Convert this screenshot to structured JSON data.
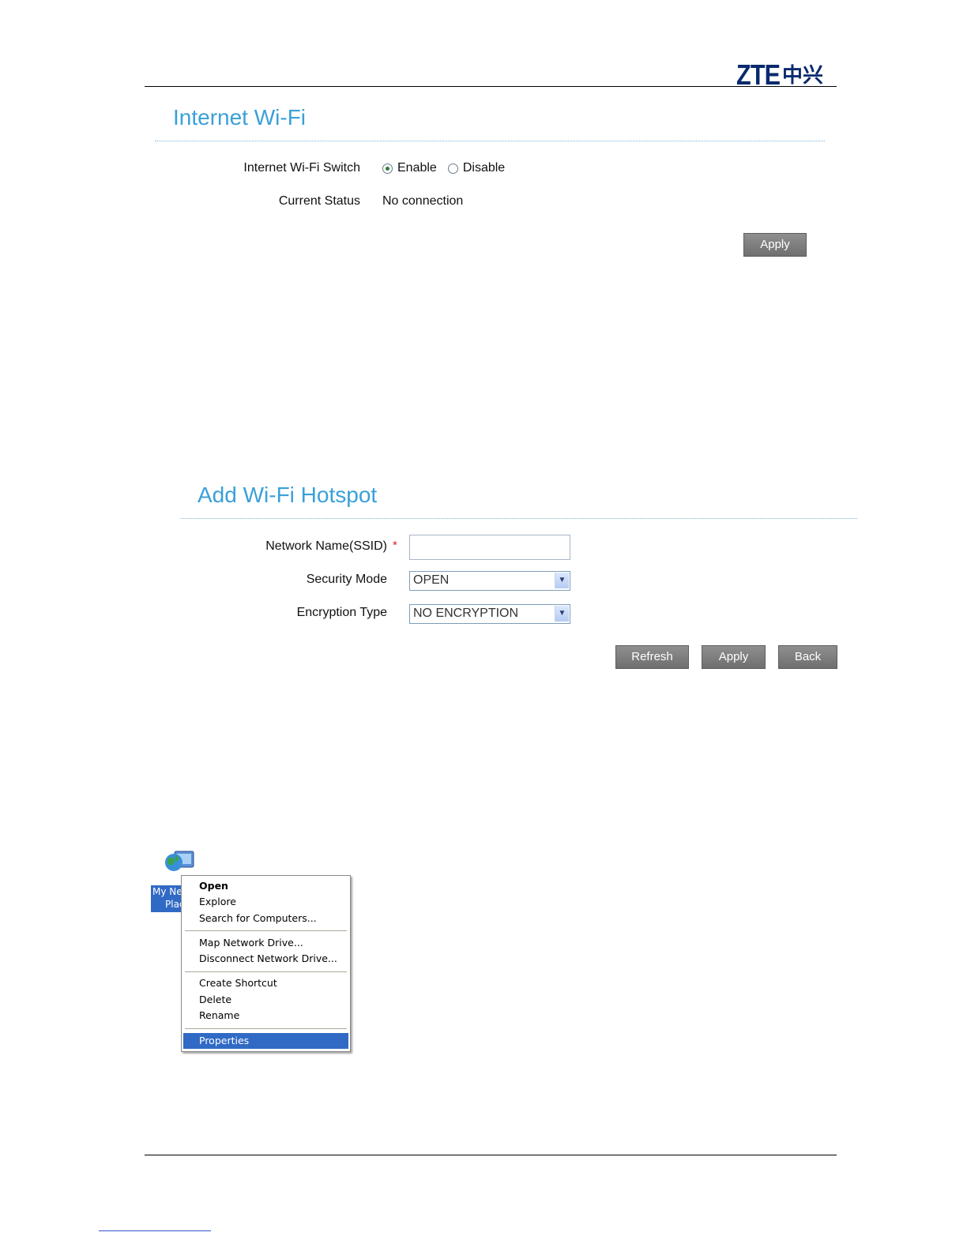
{
  "header": {
    "logo_latin": "ZTE",
    "logo_chinese": "中兴"
  },
  "internet_wifi": {
    "title": "Internet Wi-Fi",
    "switch_label": "Internet Wi-Fi Switch",
    "enable_label": "Enable",
    "disable_label": "Disable",
    "selected": "Enable",
    "status_label": "Current Status",
    "status_value": "No connection",
    "apply_label": "Apply"
  },
  "add_hotspot": {
    "title": "Add Wi-Fi Hotspot",
    "ssid_label": "Network Name(SSID)",
    "required_mark": "*",
    "ssid_value": "",
    "security_label": "Security Mode",
    "security_value": "OPEN",
    "encryption_label": "Encryption Type",
    "encryption_value": "NO ENCRYPTION",
    "refresh_label": "Refresh",
    "apply_label": "Apply",
    "back_label": "Back"
  },
  "desktop": {
    "icon_name": "network-globe-icon",
    "icon_label_line1": "My Ne",
    "icon_label_line2": "Plac"
  },
  "context_menu": {
    "items": [
      {
        "label": "Open"
      },
      {
        "label": "Explore"
      },
      {
        "label": "Search for Computers..."
      },
      {
        "label": "Map Network Drive..."
      },
      {
        "label": "Disconnect Network Drive..."
      },
      {
        "label": "Create Shortcut"
      },
      {
        "label": "Delete"
      },
      {
        "label": "Rename"
      },
      {
        "label": "Properties"
      }
    ],
    "selected": "Properties"
  },
  "colors": {
    "title_blue": "#3aa0d8",
    "button_gray": "#7f7f7f",
    "selection_blue": "#316ac5",
    "logo_navy": "#0a2a6e",
    "required_red": "#e02020"
  }
}
